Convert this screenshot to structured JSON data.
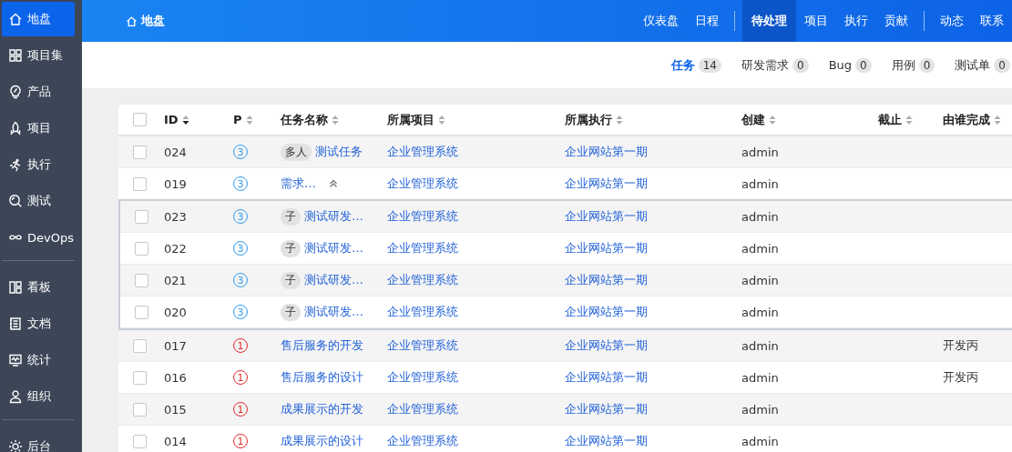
{
  "sidebar": {
    "sections": [
      {
        "items": [
          {
            "label": "地盘",
            "selected": true
          },
          {
            "label": "项目集",
            "selected": false
          },
          {
            "label": "产品",
            "selected": false
          },
          {
            "label": "项目",
            "selected": false
          },
          {
            "label": "执行",
            "selected": false
          },
          {
            "label": "测试",
            "selected": false
          },
          {
            "label": "DevOps",
            "selected": false
          }
        ]
      },
      {
        "items": [
          {
            "label": "看板",
            "selected": false
          },
          {
            "label": "文档",
            "selected": false
          },
          {
            "label": "统计",
            "selected": false
          },
          {
            "label": "组织",
            "selected": false
          }
        ]
      },
      {
        "items": [
          {
            "label": "后台",
            "selected": false
          }
        ]
      }
    ]
  },
  "header": {
    "title": "地盘",
    "nav_groups": [
      [
        {
          "label": "仪表盘",
          "selected": false
        },
        {
          "label": "日程",
          "selected": false
        }
      ],
      [
        {
          "label": "待处理",
          "selected": true
        },
        {
          "label": "项目",
          "selected": false
        },
        {
          "label": "执行",
          "selected": false
        },
        {
          "label": "贡献",
          "selected": false
        }
      ],
      [
        {
          "label": "动态",
          "selected": false
        },
        {
          "label": "联系",
          "selected": false
        }
      ]
    ]
  },
  "tabs": [
    {
      "label": "任务",
      "count": "14",
      "selected": true
    },
    {
      "label": "研发需求",
      "count": "0",
      "selected": false
    },
    {
      "label": "Bug",
      "count": "0",
      "selected": false
    },
    {
      "label": "用例",
      "count": "0",
      "selected": false
    },
    {
      "label": "测试单",
      "count": "0",
      "selected": false
    }
  ],
  "table": {
    "select_all_checked": false,
    "columns": [
      {
        "label": "ID",
        "sorted": true
      },
      {
        "label": "P",
        "sorted": false
      },
      {
        "label": "任务名称",
        "sorted": false
      },
      {
        "label": "所属项目",
        "sorted": false
      },
      {
        "label": "所属执行",
        "sorted": false
      },
      {
        "label": "创建",
        "sorted": false
      },
      {
        "label": "截止",
        "sorted": false
      },
      {
        "label": "由谁完成",
        "sorted": false
      }
    ],
    "rows": [
      {
        "id": "024",
        "checked": false,
        "priority": "3",
        "color": "#2e9af0",
        "tag": "多人",
        "name": "测试任务",
        "project": "企业管理系统",
        "execution": "企业网站第一期",
        "creator": "admin"
      },
      {
        "id": "019",
        "checked": false,
        "priority": "3",
        "color": "#2e9af0",
        "name": "需求…",
        "expanded": true,
        "project": "企业管理系统",
        "execution": "企业网站第一期",
        "creator": "admin",
        "children": [
          {
            "id": "023",
            "checked": false,
            "priority": "3",
            "color": "#2e9af0",
            "tag": "子",
            "name": "测试研发…",
            "project": "企业管理系统",
            "execution": "企业网站第一期",
            "creator": "admin"
          },
          {
            "id": "022",
            "checked": false,
            "priority": "3",
            "color": "#2e9af0",
            "tag": "子",
            "name": "测试研发…",
            "project": "企业管理系统",
            "execution": "企业网站第一期",
            "creator": "admin"
          },
          {
            "id": "021",
            "checked": false,
            "priority": "3",
            "color": "#2e9af0",
            "tag": "子",
            "name": "测试研发…",
            "project": "企业管理系统",
            "execution": "企业网站第一期",
            "creator": "admin"
          },
          {
            "id": "020",
            "checked": false,
            "priority": "3",
            "color": "#2e9af0",
            "tag": "子",
            "name": "测试研发…",
            "project": "企业管理系统",
            "execution": "企业网站第一期",
            "creator": "admin"
          }
        ]
      },
      {
        "id": "017",
        "checked": false,
        "priority": "1",
        "color": "#e52a2a",
        "name": "售后服务的开发",
        "project": "企业管理系统",
        "execution": "企业网站第一期",
        "creator": "admin",
        "finished_by": "开发丙"
      },
      {
        "id": "016",
        "checked": false,
        "priority": "1",
        "color": "#e52a2a",
        "name": "售后服务的设计",
        "project": "企业管理系统",
        "execution": "企业网站第一期",
        "creator": "admin",
        "finished_by": "开发丙"
      },
      {
        "id": "015",
        "checked": false,
        "priority": "1",
        "color": "#e52a2a",
        "name": "成果展示的开发",
        "project": "企业管理系统",
        "execution": "企业网站第一期",
        "creator": "admin"
      },
      {
        "id": "014",
        "checked": false,
        "priority": "1",
        "color": "#e52a2a",
        "name": "成果展示的设计",
        "project": "企业管理系统",
        "execution": "企业网站第一期",
        "creator": "admin"
      }
    ]
  }
}
